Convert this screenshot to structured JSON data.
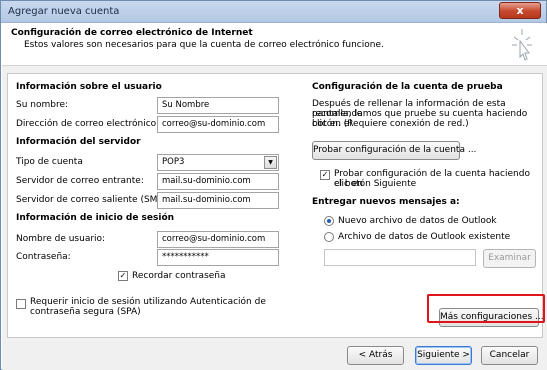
{
  "window": {
    "title": "Agregar nueva cuenta",
    "close_label": "x"
  },
  "header": {
    "title": "Configuración de correo electrónico de Internet",
    "subtitle": "Estos valores son necesarios para que la cuenta de correo electrónico funcione."
  },
  "user_info": {
    "section": "Información sobre el usuario",
    "name_label": "Su nombre:",
    "name_value": "Su Nombre",
    "email_label": "Dirección de correo electrónico:",
    "email_value": "correo@su-dominio.com"
  },
  "server_info": {
    "section": "Información del servidor",
    "account_type_label": "Tipo de cuenta",
    "account_type_value": "POP3",
    "incoming_label": "Servidor de correo entrante:",
    "incoming_value": "mail.su-dominio.com",
    "outgoing_label": "Servidor de correo saliente (SMTP):",
    "outgoing_value": "mail.su-dominio.com"
  },
  "logon_info": {
    "section": "Información de inicio de sesión",
    "username_label": "Nombre de usuario:",
    "username_value": "correo@su-dominio.com",
    "password_label": "Contraseña:",
    "password_value": "***********",
    "remember_label": "Recordar contraseña",
    "remember_checked": true,
    "spa_label_line1": "Requerir inicio de sesión utilizando Autenticación de",
    "spa_label_line2": "contraseña segura (SPA)",
    "spa_checked": false
  },
  "test_settings": {
    "section": "Configuración de la cuenta de prueba",
    "description_line1": "Después de rellenar la información de esta pantalla, le",
    "description_line2": "recomendamos que pruebe su cuenta haciendo clic en el",
    "description_line3": "botón. (Requiere conexión de red.)",
    "test_button": "Probar configuración de la cuenta ...",
    "auto_test_line1": "Probar configuración de la cuenta haciendo clic en",
    "auto_test_line2": "el botón Siguiente",
    "auto_test_checked": true
  },
  "deliver": {
    "section": "Entregar nuevos mensajes a:",
    "option_new": "Nuevo archivo de datos de Outlook",
    "option_existing": "Archivo de datos de Outlook existente",
    "browse_button": "Examinar"
  },
  "more_settings_button": "Más configuraciones ...",
  "footer": {
    "back_button": "< Atrás",
    "next_button": "Siguiente >",
    "cancel_button": "Cancelar"
  }
}
